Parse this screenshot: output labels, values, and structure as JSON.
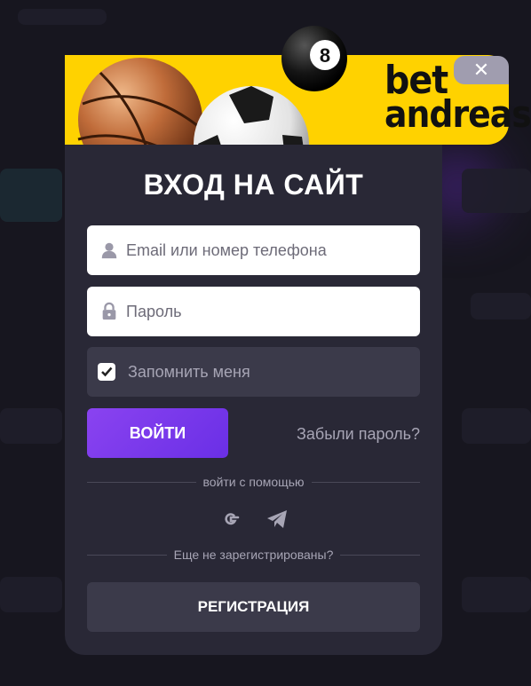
{
  "brand": {
    "line1": "bet",
    "line2": "andreas",
    "ball_number": "8"
  },
  "modal": {
    "close_label": "✕",
    "title": "ВХОД НА САЙТ",
    "login_field": {
      "placeholder": "Email или номер телефона",
      "value": ""
    },
    "password_field": {
      "placeholder": "Пароль",
      "value": ""
    },
    "remember": {
      "label": "Запомнить меня",
      "checked": true
    },
    "login_button": "ВОЙТИ",
    "forgot_link": "Забыли пароль?",
    "social_divider": "войти с помощью",
    "socials": [
      "google-icon",
      "telegram-icon"
    ],
    "register_divider": "Еще не зарегистрированы?",
    "register_button": "РЕГИСТРАЦИЯ"
  },
  "colors": {
    "banner": "#ffd200",
    "modal_bg": "#292836",
    "accent": "#7b3aec",
    "secondary_bg": "#3b3a4a"
  }
}
